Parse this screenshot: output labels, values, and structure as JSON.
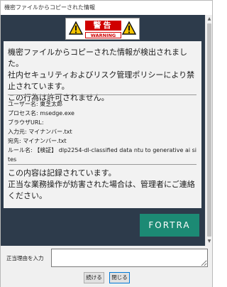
{
  "window": {
    "title": "機密ファイルからコピーされた情報"
  },
  "warning_sign": {
    "title_jp": "警告",
    "title_en": "WARNING"
  },
  "message": {
    "line1": "機密ファイルからコピーされた情報が検出されました。",
    "line2": "社内セキュリティおよびリスク管理ポリシーにより禁止されています。",
    "line3": "この行為は許可されません。"
  },
  "details": {
    "user": "ユーザー名: 東芝太郎",
    "process": "プロセス名: msedge.exe",
    "browser_url": "ブラウザURL:",
    "source": "入力元: マイナンバー.txt",
    "destination": "宛先: マイナンバー.txt",
    "rule": "ルール名: 【検証】 dlp2254-dl-classified data ntu to generative ai sites"
  },
  "footer": {
    "line1": "この内容は記録されています。",
    "line2": "正当な業務操作が妨害された場合は、管理者にご連絡ください。"
  },
  "brand": {
    "logo_text": "FORTRA",
    "color": "#1c8a74"
  },
  "reason": {
    "label": "正当理由を入力",
    "value": ""
  },
  "buttons": {
    "continue": "続ける",
    "close": "閉じる"
  },
  "colors": {
    "content_bg": "#2d3b4b",
    "warning_red": "#d00000"
  }
}
